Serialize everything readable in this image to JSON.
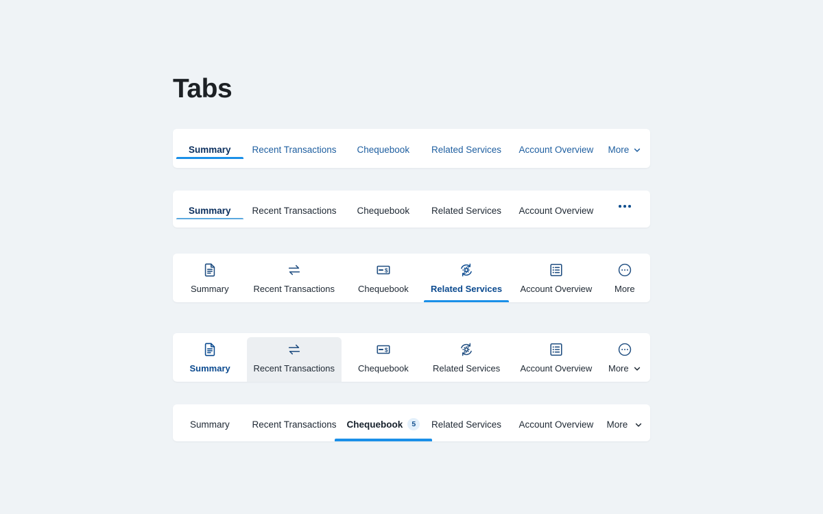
{
  "page": {
    "title": "Tabs",
    "background_color": "#eff3f6",
    "accent_color": "#1a8fe8",
    "link_color": "#1f5fa0",
    "active_color": "#0b2f5e"
  },
  "tabsets": [
    {
      "id": "link-tabs",
      "style": "text-links",
      "tabs": [
        {
          "label": "Summary",
          "active": true
        },
        {
          "label": "Recent Transactions",
          "active": false
        },
        {
          "label": "Chequebook",
          "active": false
        },
        {
          "label": "Related Services",
          "active": false
        },
        {
          "label": "Account Overview",
          "active": false
        },
        {
          "label": "More",
          "active": false,
          "overflow": "chevron-down"
        }
      ]
    },
    {
      "id": "dark-tabs",
      "style": "text-dark",
      "tabs": [
        {
          "label": "Summary",
          "active": true
        },
        {
          "label": "Recent Transactions",
          "active": false
        },
        {
          "label": "Chequebook",
          "active": false
        },
        {
          "label": "Related Services",
          "active": false
        },
        {
          "label": "Account Overview",
          "active": false
        },
        {
          "label": "",
          "active": false,
          "overflow": "kebab"
        }
      ]
    },
    {
      "id": "icon-tabs",
      "style": "icon-over-label",
      "tabs": [
        {
          "label": "Summary",
          "icon": "document-icon",
          "active": false
        },
        {
          "label": "Recent Transactions",
          "icon": "transfer-arrows-icon",
          "active": false
        },
        {
          "label": "Chequebook",
          "icon": "cheque-dollar-icon",
          "active": false
        },
        {
          "label": "Related Services",
          "icon": "gear-refresh-icon",
          "active": true
        },
        {
          "label": "Account Overview",
          "icon": "list-document-icon",
          "active": false
        },
        {
          "label": "More",
          "icon": "circle-ellipsis-icon",
          "active": false
        }
      ]
    },
    {
      "id": "icon-tabs-hover",
      "style": "icon-over-label",
      "tabs": [
        {
          "label": "Summary",
          "icon": "document-icon",
          "active": true
        },
        {
          "label": "Recent Transactions",
          "icon": "transfer-arrows-icon",
          "active": false,
          "hovered": true
        },
        {
          "label": "Chequebook",
          "icon": "cheque-dollar-icon",
          "active": false
        },
        {
          "label": "Related Services",
          "icon": "gear-refresh-icon",
          "active": false
        },
        {
          "label": "Account Overview",
          "icon": "list-document-icon",
          "active": false
        },
        {
          "label": "More",
          "icon": "circle-ellipsis-icon",
          "active": false,
          "overflow": "chevron-down"
        }
      ]
    },
    {
      "id": "badge-tabs",
      "style": "text-dark-badge",
      "tabs": [
        {
          "label": "Summary",
          "active": false
        },
        {
          "label": "Recent Transactions",
          "active": false
        },
        {
          "label": "Chequebook",
          "active": true,
          "badge": "5"
        },
        {
          "label": "Related Services",
          "active": false
        },
        {
          "label": "Account Overview",
          "active": false
        },
        {
          "label": "More",
          "active": false,
          "overflow": "chevron-down"
        }
      ]
    }
  ]
}
